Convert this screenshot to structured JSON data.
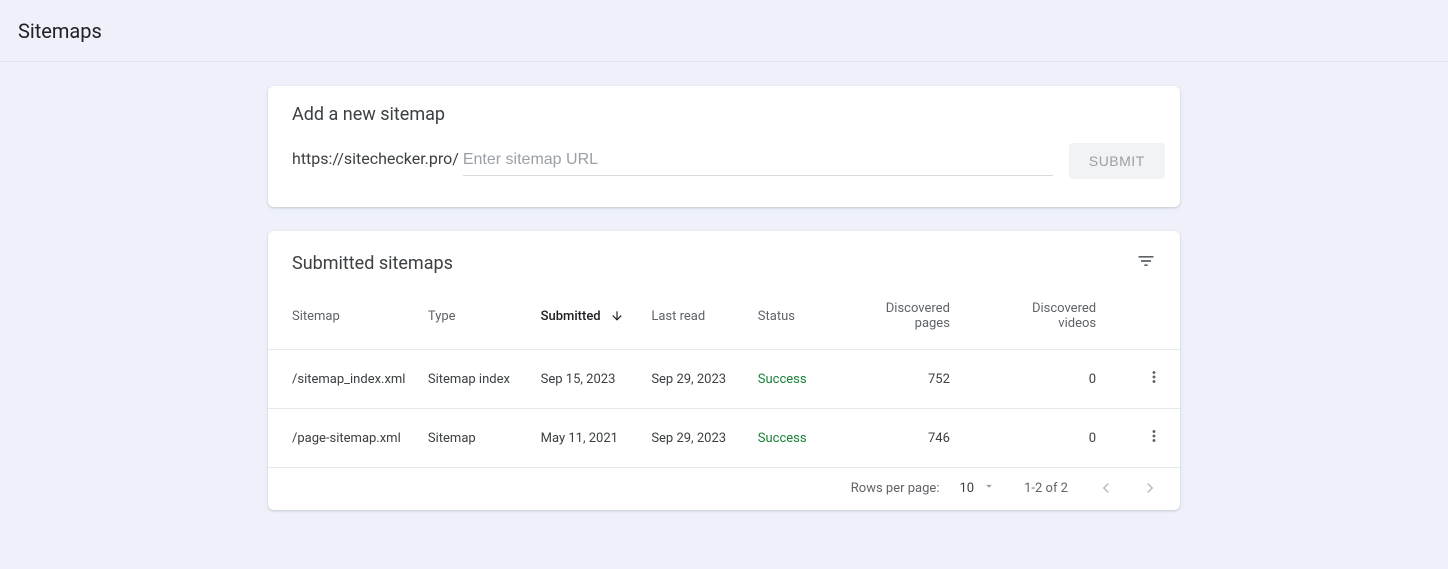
{
  "header": {
    "title": "Sitemaps"
  },
  "add_card": {
    "title": "Add a new sitemap",
    "url_prefix": "https://sitechecker.pro/",
    "placeholder": "Enter sitemap URL",
    "submit_label": "SUBMIT"
  },
  "submitted": {
    "title": "Submitted sitemaps",
    "columns": {
      "sitemap": "Sitemap",
      "type": "Type",
      "submitted": "Submitted",
      "last_read": "Last read",
      "status": "Status",
      "discovered_pages": "Discovered pages",
      "discovered_videos": "Discovered videos"
    },
    "rows": [
      {
        "sitemap": "/sitemap_index.xml",
        "type": "Sitemap index",
        "submitted": "Sep 15, 2023",
        "last_read": "Sep 29, 2023",
        "status": "Success",
        "pages": "752",
        "videos": "0"
      },
      {
        "sitemap": "/page-sitemap.xml",
        "type": "Sitemap",
        "submitted": "May 11, 2021",
        "last_read": "Sep 29, 2023",
        "status": "Success",
        "pages": "746",
        "videos": "0"
      }
    ],
    "pagination": {
      "rows_label": "Rows per page:",
      "rows_value": "10",
      "range": "1-2 of 2"
    }
  }
}
